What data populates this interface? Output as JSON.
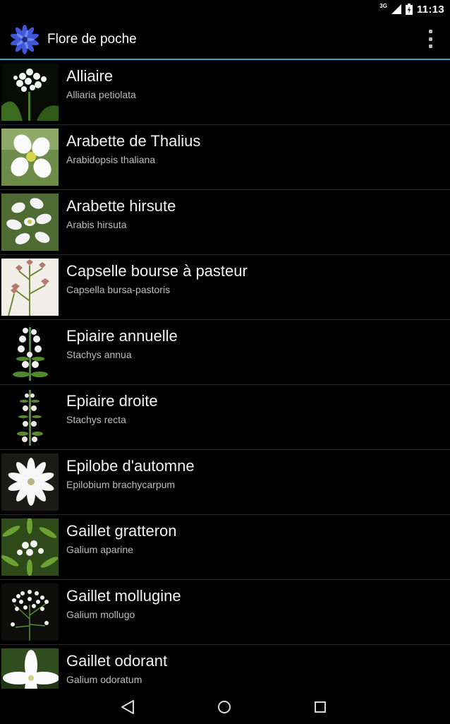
{
  "status_bar": {
    "network": "3G",
    "time": "11:13"
  },
  "action_bar": {
    "title": "Flore de poche",
    "logo_icon": "cornflower-logo-icon",
    "overflow_icon": "overflow-menu-icon"
  },
  "plants": [
    {
      "common": "Alliaire",
      "latin": "Alliaria petiolata",
      "photo": "white-cluster"
    },
    {
      "common": "Arabette de Thalius",
      "latin": "Arabidopsis thaliana",
      "photo": "four-petal-large"
    },
    {
      "common": "Arabette hirsute",
      "latin": "Arabis hirsuta",
      "photo": "four-petal-group"
    },
    {
      "common": "Capselle bourse à pasteur",
      "latin": "Capsella bursa-pastoris",
      "photo": "pods"
    },
    {
      "common": "Epiaire annuelle",
      "latin": "Stachys annua",
      "photo": "spike"
    },
    {
      "common": "Epiaire droite",
      "latin": "Stachys recta",
      "photo": "tall-spike"
    },
    {
      "common": "Epilobe d'automne",
      "latin": "Epilobium brachycarpum",
      "photo": "star"
    },
    {
      "common": "Gaillet gratteron",
      "latin": "Galium aparine",
      "photo": "green-leaves"
    },
    {
      "common": "Gaillet mollugine",
      "latin": "Galium mollugo",
      "photo": "tiny-cluster"
    },
    {
      "common": "Gaillet odorant",
      "latin": "Galium odoratum",
      "photo": "single-star"
    }
  ],
  "nav_bar": {
    "back_icon": "back-icon",
    "home_icon": "home-icon",
    "recents_icon": "recents-icon"
  },
  "colors": {
    "accent_divider": "#3aa3c8",
    "background": "#000000",
    "secondary_text": "#bdbdbd"
  }
}
